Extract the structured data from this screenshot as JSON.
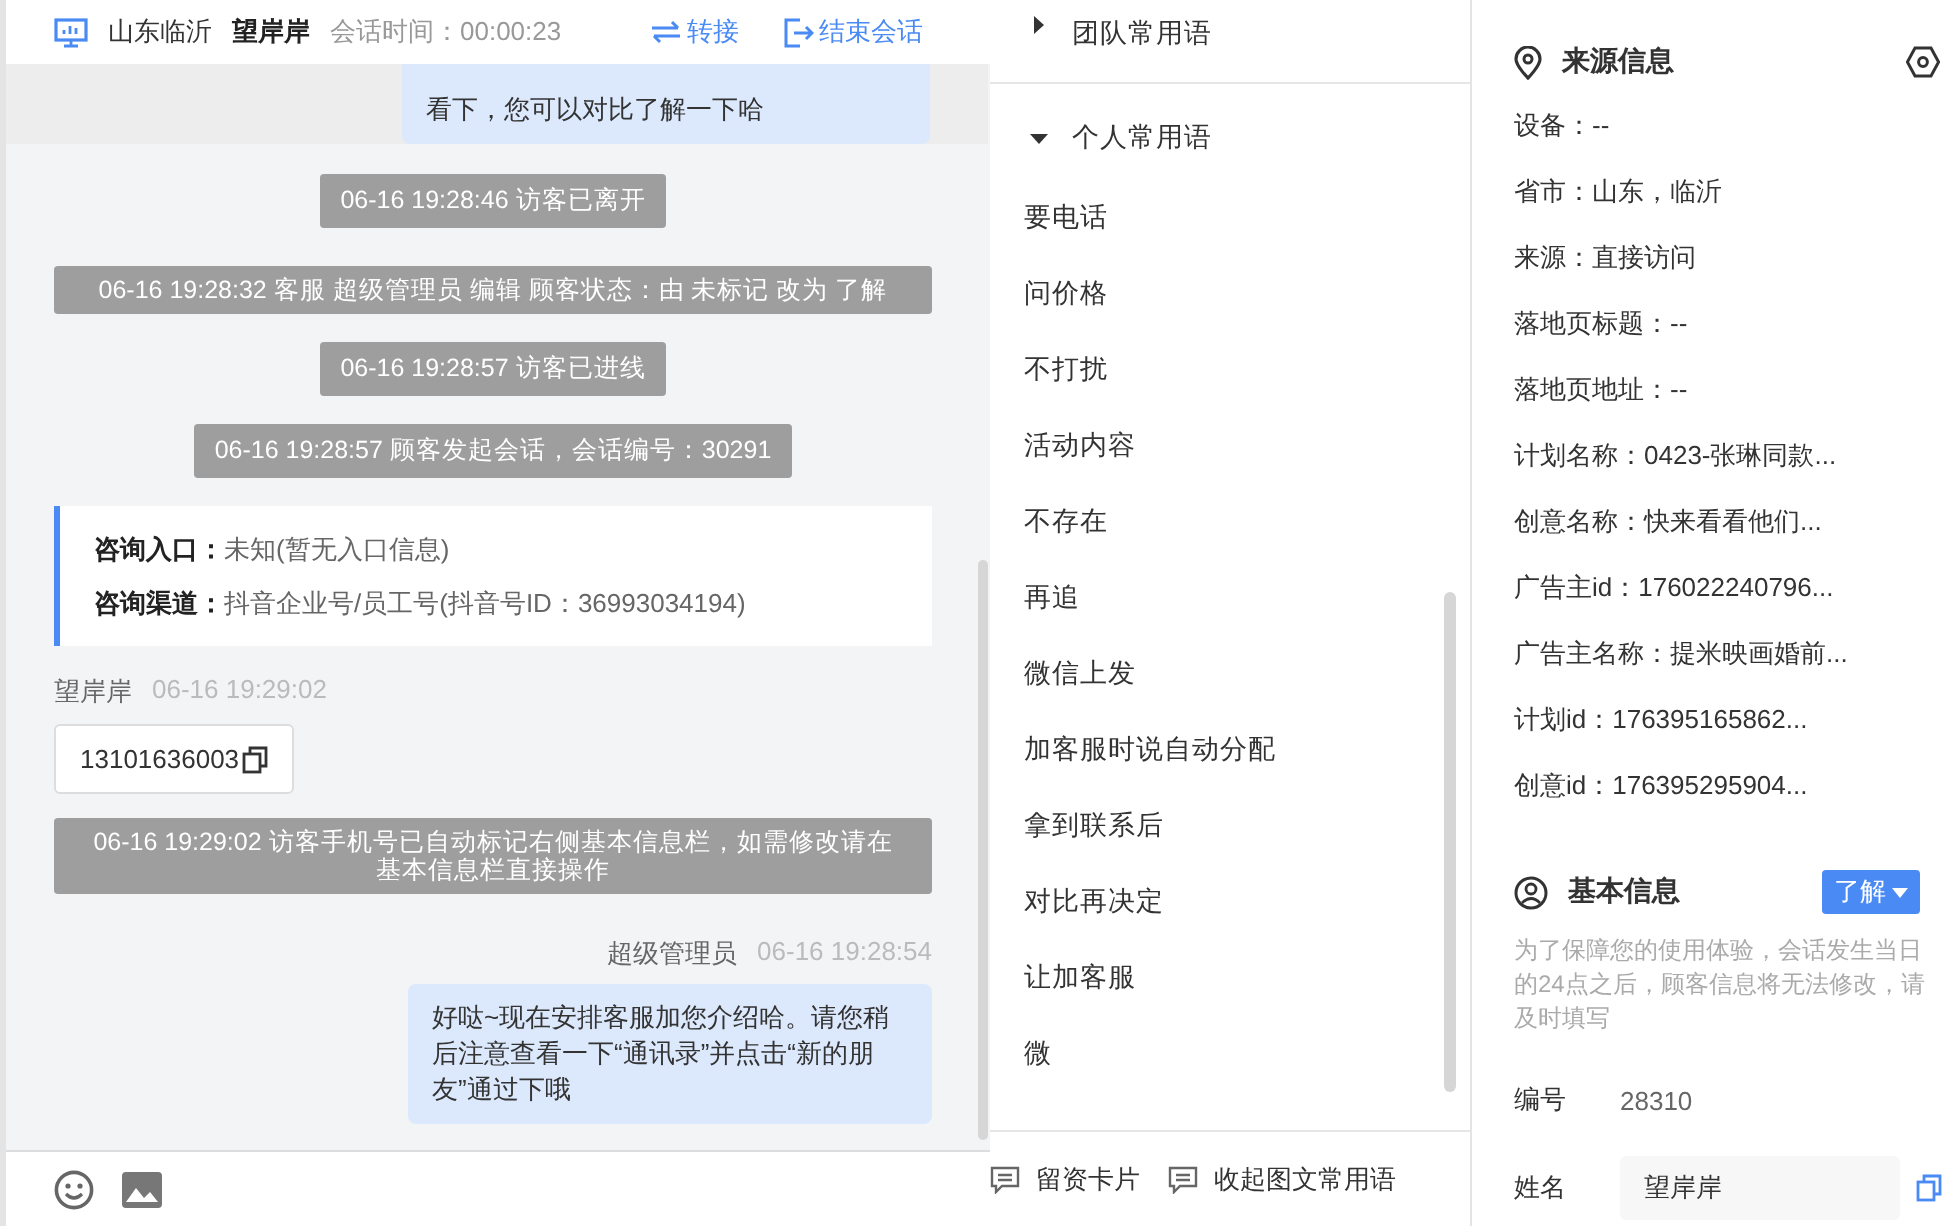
{
  "header": {
    "location": "山东临沂",
    "visitor": "望岸岸",
    "session_time": "会话时间：00:00:23",
    "actions": [
      {
        "kind": "transfer",
        "label": "转接"
      },
      {
        "kind": "end",
        "label": "结束会话"
      }
    ]
  },
  "messages": [
    {
      "kind": "clipped_out",
      "text": "看下，您可以对比了解一下哈"
    },
    {
      "kind": "system",
      "text": "06-16 19:28:46 访客已离开"
    },
    {
      "kind": "system",
      "text": "06-16 19:28:32 客服 超级管理员 编辑 顾客状态：由 未标记 改为 了解"
    },
    {
      "kind": "system",
      "text": "06-16 19:28:57 访客已进线"
    },
    {
      "kind": "system",
      "text": "06-16 19:28:57 顾客发起会话，会话编号：30291"
    },
    {
      "kind": "card",
      "rows": [
        {
          "label": "咨询入口：",
          "value": "未知(暂无入口信息)"
        },
        {
          "label": "咨询渠道：",
          "value": "抖音企业号/员工号(抖音号ID：36993034194)"
        }
      ]
    },
    {
      "kind": "in",
      "sender": "望岸岸",
      "time": "06-16 19:29:02",
      "text": "13101636003"
    },
    {
      "kind": "system",
      "text": "06-16 19:29:02 访客手机号已自动标记右侧基本信息栏，如需修改请在基本信息栏直接操作"
    },
    {
      "kind": "out",
      "sender": "超级管理员",
      "time": "06-16 19:28:54",
      "text": "好哒~现在安排客服加您介绍哈。请您稍后注意查看一下“通讯录”并点击“新的朋友”通过下哦"
    }
  ],
  "phrases": {
    "groups": [
      {
        "title": "团队常用语",
        "expanded": false
      },
      {
        "title": "个人常用语",
        "expanded": true,
        "items": [
          "要电话",
          "问价格",
          "不打扰",
          "活动内容",
          "不存在",
          "再追",
          "微信上发",
          "加客服时说自动分配",
          "拿到联系后",
          "对比再决定",
          "让加客服",
          "微"
        ]
      }
    ],
    "footer": [
      "留资卡片",
      "收起图文常用语"
    ]
  },
  "source_info": {
    "title": "来源信息",
    "fields": [
      "设备：--",
      "省市：山东，临沂",
      "来源：直接访问",
      "落地页标题：--",
      "落地页地址：--",
      "计划名称：0423-张琳同款...",
      "创意名称：快来看看他们...",
      "广告主id：176022240796...",
      "广告主名称：提米映画婚前...",
      "计划id：176395165862...",
      "创意id：176395295904..."
    ]
  },
  "basic_info": {
    "title": "基本信息",
    "status": "了解",
    "note": "为了保障您的使用体验，会话发生当日的24点之后，顾客信息将无法修改，请及时填写",
    "fields": [
      {
        "kind": "text",
        "label": "编号",
        "value": "28310"
      },
      {
        "kind": "input",
        "label": "姓名",
        "value": "望岸岸"
      }
    ]
  }
}
